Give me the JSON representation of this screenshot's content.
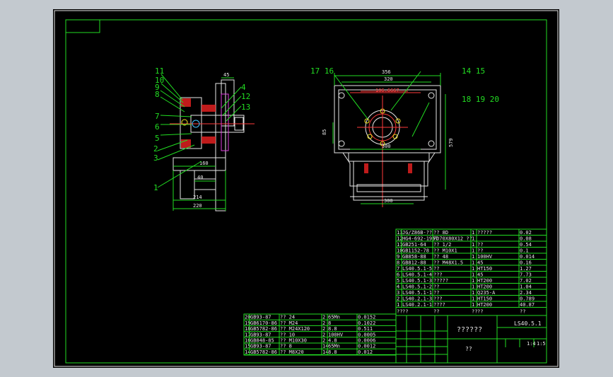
{
  "drawing": {
    "title_block": {
      "drawing_number": "LS40.5.1",
      "name": "??????",
      "sub": "??",
      "scale_note": "1:4",
      "sheet": "1:5"
    },
    "side_view": {
      "balloons": [
        "11",
        "10",
        "9",
        "8",
        "7",
        "6",
        "5",
        "2",
        "3",
        "1",
        "4",
        "12",
        "13"
      ],
      "dims": [
        "45",
        "160",
        "40",
        "214",
        "220"
      ]
    },
    "front_view": {
      "balloons": [
        "17 16",
        "14 15",
        "18 19 20"
      ],
      "dims": [
        "356",
        "320",
        "106.6667",
        "85",
        "579",
        "300",
        "300"
      ]
    },
    "parts_list_right": [
      [
        "13",
        "JG/Z86B-??",
        "?? 8D",
        "1",
        "?????",
        "0.02"
      ],
      [
        "12",
        "HG4-692-1967",
        "PD70X80X12 ??",
        "1",
        "",
        "0.08"
      ],
      [
        "11",
        "GB251-64",
        "?? 1/2",
        "1",
        "??",
        "0.54"
      ],
      [
        "10",
        "GB1152-78",
        "?? M10X1",
        "1",
        "??",
        "0.1"
      ],
      [
        "9",
        "GB858-88",
        "?? 48",
        "1",
        "100HV",
        "0.014"
      ],
      [
        "8",
        "GB812-88",
        "?? M48X1.5",
        "1",
        "45",
        "0.16"
      ],
      [
        "7",
        "LS40.5.1-5",
        "??",
        "1",
        "HT150",
        "1.27"
      ],
      [
        "6",
        "LS40.5.1-4",
        "???",
        "1",
        "45",
        "7.73"
      ],
      [
        "5",
        "LS40.5.1-3",
        "?????",
        "1",
        "HT200",
        "7.02"
      ],
      [
        "4",
        "LS40.5.1-2",
        "??",
        "1",
        "HT200",
        "1.04"
      ],
      [
        "3",
        "LS40.5.1-1",
        "??",
        "1",
        "Q235-A",
        "2.34"
      ],
      [
        "2",
        "LS40.2.1-3",
        "???",
        "1",
        "HT150",
        "0.789"
      ],
      [
        "1",
        "LS40.2.1-1",
        "????",
        "1",
        "HT200",
        "40.87"
      ]
    ],
    "parts_list_left": [
      [
        "20",
        "GB93-87",
        "?? 24",
        "2",
        "65Mn",
        "0.0152"
      ],
      [
        "19",
        "GB6170-86",
        "?? M24",
        "2",
        "8",
        "0.1022"
      ],
      [
        "18",
        "GB5782-86",
        "?? M24X120",
        "2",
        "8.8",
        "0.511"
      ],
      [
        "17",
        "GB93-87",
        "?? 10",
        "2",
        "100HV",
        "0.0005"
      ],
      [
        "16",
        "GB848-85",
        "?? M10X30",
        "2",
        "4.8",
        "0.0006"
      ],
      [
        "15",
        "GB93-87",
        "?? 8",
        "14",
        "65Mn",
        "0.0012"
      ],
      [
        "14",
        "GB5782-86",
        "?? M8X20",
        "14",
        "8.8",
        "0.012"
      ]
    ],
    "header_row": [
      "??",
      "??",
      "??",
      "??",
      "??",
      "??"
    ]
  },
  "colors": {
    "background": "#000000",
    "frame": "#22dd22",
    "outline": "#e8e8e8",
    "centerline": "#ff3a3a",
    "hatch": "#e02020"
  }
}
